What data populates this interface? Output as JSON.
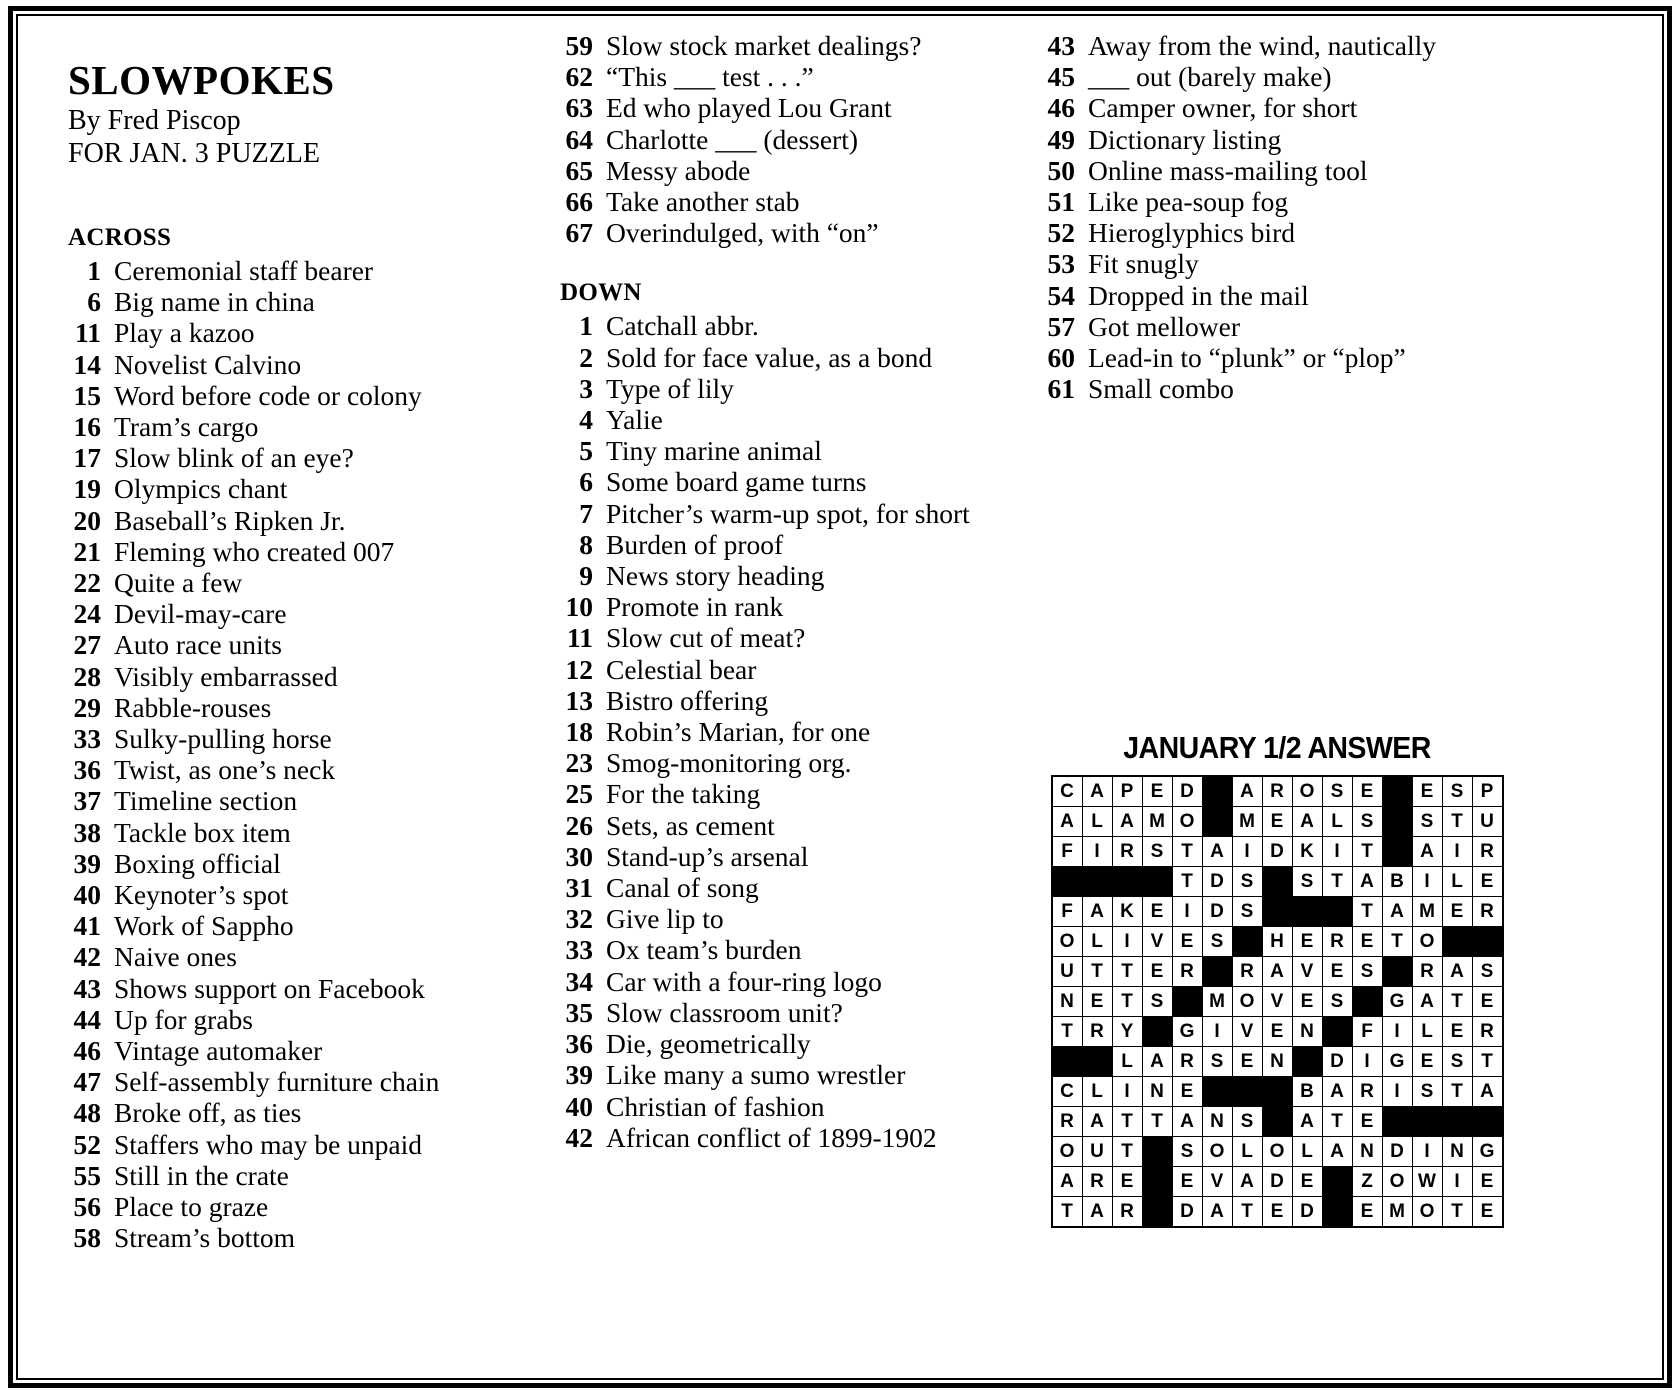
{
  "header": {
    "title": "SLOWPOKES",
    "byline": "By Fred Piscop",
    "forline": "FOR JAN. 3 PUZZLE"
  },
  "sections": {
    "across_label": "ACROSS",
    "down_label": "DOWN"
  },
  "across": [
    {
      "num": "1",
      "clue": "Ceremonial staff bearer"
    },
    {
      "num": "6",
      "clue": "Big name in china"
    },
    {
      "num": "11",
      "clue": "Play a kazoo"
    },
    {
      "num": "14",
      "clue": "Novelist Calvino"
    },
    {
      "num": "15",
      "clue": "Word before code or colony"
    },
    {
      "num": "16",
      "clue": "Tram’s cargo"
    },
    {
      "num": "17",
      "clue": "Slow blink of an eye?"
    },
    {
      "num": "19",
      "clue": "Olympics chant"
    },
    {
      "num": "20",
      "clue": "Baseball’s Ripken Jr."
    },
    {
      "num": "21",
      "clue": "Fleming who created 007"
    },
    {
      "num": "22",
      "clue": "Quite a few"
    },
    {
      "num": "24",
      "clue": "Devil-may-care"
    },
    {
      "num": "27",
      "clue": "Auto race units"
    },
    {
      "num": "28",
      "clue": "Visibly embarrassed"
    },
    {
      "num": "29",
      "clue": "Rabble-rouses"
    },
    {
      "num": "33",
      "clue": "Sulky-pulling horse"
    },
    {
      "num": "36",
      "clue": "Twist, as one’s neck"
    },
    {
      "num": "37",
      "clue": "Timeline section"
    },
    {
      "num": "38",
      "clue": "Tackle box item"
    },
    {
      "num": "39",
      "clue": "Boxing official"
    },
    {
      "num": "40",
      "clue": "Keynoter’s spot"
    },
    {
      "num": "41",
      "clue": "Work of Sappho"
    },
    {
      "num": "42",
      "clue": "Naive ones"
    },
    {
      "num": "43",
      "clue": "Shows support on Facebook"
    },
    {
      "num": "44",
      "clue": "Up for grabs"
    },
    {
      "num": "46",
      "clue": "Vintage automaker"
    },
    {
      "num": "47",
      "clue": "Self-assembly furniture chain"
    },
    {
      "num": "48",
      "clue": "Broke off, as ties"
    },
    {
      "num": "52",
      "clue": "Staffers who may be unpaid"
    },
    {
      "num": "55",
      "clue": "Still in the crate"
    },
    {
      "num": "56",
      "clue": "Place to graze"
    },
    {
      "num": "58",
      "clue": "Stream’s bottom"
    },
    {
      "num": "59",
      "clue": "Slow stock market dealings?"
    },
    {
      "num": "62",
      "clue": "“This ___ test . . .”"
    },
    {
      "num": "63",
      "clue": "Ed who played Lou Grant"
    },
    {
      "num": "64",
      "clue": "Charlotte ___ (dessert)"
    },
    {
      "num": "65",
      "clue": "Messy abode"
    },
    {
      "num": "66",
      "clue": "Take another stab"
    },
    {
      "num": "67",
      "clue": "Overindulged, with “on”"
    }
  ],
  "down": [
    {
      "num": "1",
      "clue": "Catchall abbr."
    },
    {
      "num": "2",
      "clue": "Sold for face value, as a bond"
    },
    {
      "num": "3",
      "clue": "Type of lily"
    },
    {
      "num": "4",
      "clue": "Yalie"
    },
    {
      "num": "5",
      "clue": "Tiny marine animal"
    },
    {
      "num": "6",
      "clue": "Some board game turns"
    },
    {
      "num": "7",
      "clue": "Pitcher’s warm-up spot, for short"
    },
    {
      "num": "8",
      "clue": "Burden of proof"
    },
    {
      "num": "9",
      "clue": "News story heading"
    },
    {
      "num": "10",
      "clue": "Promote in rank"
    },
    {
      "num": "11",
      "clue": "Slow cut of meat?"
    },
    {
      "num": "12",
      "clue": "Celestial bear"
    },
    {
      "num": "13",
      "clue": "Bistro offering"
    },
    {
      "num": "18",
      "clue": "Robin’s Marian, for one"
    },
    {
      "num": "23",
      "clue": "Smog-monitoring org."
    },
    {
      "num": "25",
      "clue": "For the taking"
    },
    {
      "num": "26",
      "clue": "Sets, as cement"
    },
    {
      "num": "30",
      "clue": "Stand-up’s arsenal"
    },
    {
      "num": "31",
      "clue": "Canal of song"
    },
    {
      "num": "32",
      "clue": "Give lip to"
    },
    {
      "num": "33",
      "clue": "Ox team’s burden"
    },
    {
      "num": "34",
      "clue": "Car with a four-ring logo"
    },
    {
      "num": "35",
      "clue": "Slow classroom unit?"
    },
    {
      "num": "36",
      "clue": "Die, geometrically"
    },
    {
      "num": "39",
      "clue": "Like many a sumo wrestler"
    },
    {
      "num": "40",
      "clue": "Christian of fashion"
    },
    {
      "num": "42",
      "clue": "African conflict of 1899-1902"
    },
    {
      "num": "43",
      "clue": "Away from the wind, nautically"
    },
    {
      "num": "45",
      "clue": "___ out (barely make)"
    },
    {
      "num": "46",
      "clue": "Camper owner, for short"
    },
    {
      "num": "49",
      "clue": "Dictionary listing"
    },
    {
      "num": "50",
      "clue": "Online mass-mailing tool"
    },
    {
      "num": "51",
      "clue": "Like pea-soup fog"
    },
    {
      "num": "52",
      "clue": "Hieroglyphics bird"
    },
    {
      "num": "53",
      "clue": "Fit snugly"
    },
    {
      "num": "54",
      "clue": "Dropped in the mail"
    },
    {
      "num": "57",
      "clue": "Got mellower"
    },
    {
      "num": "60",
      "clue": "Lead-in to “plunk” or “plop”"
    },
    {
      "num": "61",
      "clue": "Small combo"
    }
  ],
  "answer": {
    "title": "JANUARY 1/2 ANSWER",
    "rows": 15,
    "cols": 15,
    "grid": [
      [
        "C",
        "A",
        "P",
        "E",
        "D",
        "#",
        "A",
        "R",
        "O",
        "S",
        "E",
        "#",
        "E",
        "S",
        "P"
      ],
      [
        "A",
        "L",
        "A",
        "M",
        "O",
        "#",
        "M",
        "E",
        "A",
        "L",
        "S",
        "#",
        "S",
        "T",
        "U"
      ],
      [
        "F",
        "I",
        "R",
        "S",
        "T",
        "A",
        "I",
        "D",
        "K",
        "I",
        "T",
        "#",
        "A",
        "I",
        "R"
      ],
      [
        "#",
        "#",
        "#",
        "#",
        "T",
        "D",
        "S",
        "#",
        "S",
        "T",
        "A",
        "B",
        "I",
        "L",
        "E"
      ],
      [
        "F",
        "A",
        "K",
        "E",
        "I",
        "D",
        "S",
        "#",
        "#",
        "#",
        "T",
        "A",
        "M",
        "E",
        "R"
      ],
      [
        "O",
        "L",
        "I",
        "V",
        "E",
        "S",
        "#",
        "H",
        "E",
        "R",
        "E",
        "T",
        "O",
        "#",
        "#"
      ],
      [
        "U",
        "T",
        "T",
        "E",
        "R",
        "#",
        "R",
        "A",
        "V",
        "E",
        "S",
        "#",
        "R",
        "A",
        "S"
      ],
      [
        "N",
        "E",
        "T",
        "S",
        "#",
        "M",
        "O",
        "V",
        "E",
        "S",
        "#",
        "G",
        "A",
        "T",
        "E"
      ],
      [
        "T",
        "R",
        "Y",
        "#",
        "G",
        "I",
        "V",
        "E",
        "N",
        "#",
        "F",
        "I",
        "L",
        "E",
        "R"
      ],
      [
        "#",
        "#",
        "L",
        "A",
        "R",
        "S",
        "E",
        "N",
        "#",
        "D",
        "I",
        "G",
        "E",
        "S",
        "T"
      ],
      [
        "C",
        "L",
        "I",
        "N",
        "E",
        "#",
        "#",
        "#",
        "B",
        "A",
        "R",
        "I",
        "S",
        "T",
        "A"
      ],
      [
        "R",
        "A",
        "T",
        "T",
        "A",
        "N",
        "S",
        "#",
        "A",
        "T",
        "E",
        "#",
        "#",
        "#",
        "#"
      ],
      [
        "O",
        "U",
        "T",
        "#",
        "S",
        "O",
        "L",
        "O",
        "L",
        "A",
        "N",
        "D",
        "I",
        "N",
        "G"
      ],
      [
        "A",
        "R",
        "E",
        "#",
        "E",
        "V",
        "A",
        "D",
        "E",
        "#",
        "Z",
        "O",
        "W",
        "I",
        "E"
      ],
      [
        "T",
        "A",
        "R",
        "#",
        "D",
        "A",
        "T",
        "E",
        "D",
        "#",
        "E",
        "M",
        "O",
        "T",
        "E"
      ]
    ]
  }
}
